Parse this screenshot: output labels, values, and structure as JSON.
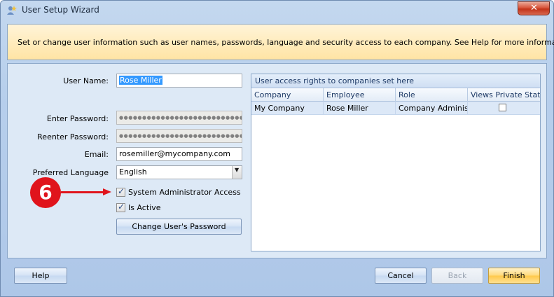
{
  "window": {
    "title": "User Setup Wizard",
    "close_glyph": "✕"
  },
  "banner": {
    "text": "Set or change user information such as user names, passwords, language and security access to each company. See Help for more information."
  },
  "form": {
    "user_name_label": "User Name:",
    "user_name_value": "Rose Miller",
    "enter_password_label": "Enter Password:",
    "enter_password_value": "●●●●●●●●●●●●●●●●●●●●●●●●●●●",
    "reenter_password_label": "Reenter Password:",
    "reenter_password_value": "●●●●●●●●●●●●●●●●●●●●●●●●●●●",
    "email_label": "Email:",
    "email_value": "rosemiller@mycompany.com",
    "language_label": "Preferred Language",
    "language_value": "English",
    "sysadmin_label": "System Administrator Access",
    "sysadmin_checked": true,
    "active_label": "Is Active",
    "active_checked": true,
    "change_password_label": "Change User's Password"
  },
  "grid": {
    "caption": "User access rights to companies set here",
    "columns": [
      "Company",
      "Employee",
      "Role",
      "Views Private Stats"
    ],
    "rows": [
      {
        "company": "My Company",
        "employee": "Rose Miller",
        "role": "Company Adminis...",
        "views_private_stats": false
      }
    ]
  },
  "annotation": {
    "step_number": "6",
    "color": "#e0141c"
  },
  "footer": {
    "help_label": "Help",
    "cancel_label": "Cancel",
    "back_label": "Back",
    "finish_label": "Finish"
  },
  "colors": {
    "banner_bg": "#ffe4a4",
    "panel_bg": "#dde9f6",
    "selection": "#3399ff",
    "finish_button": "#ffc94a"
  }
}
